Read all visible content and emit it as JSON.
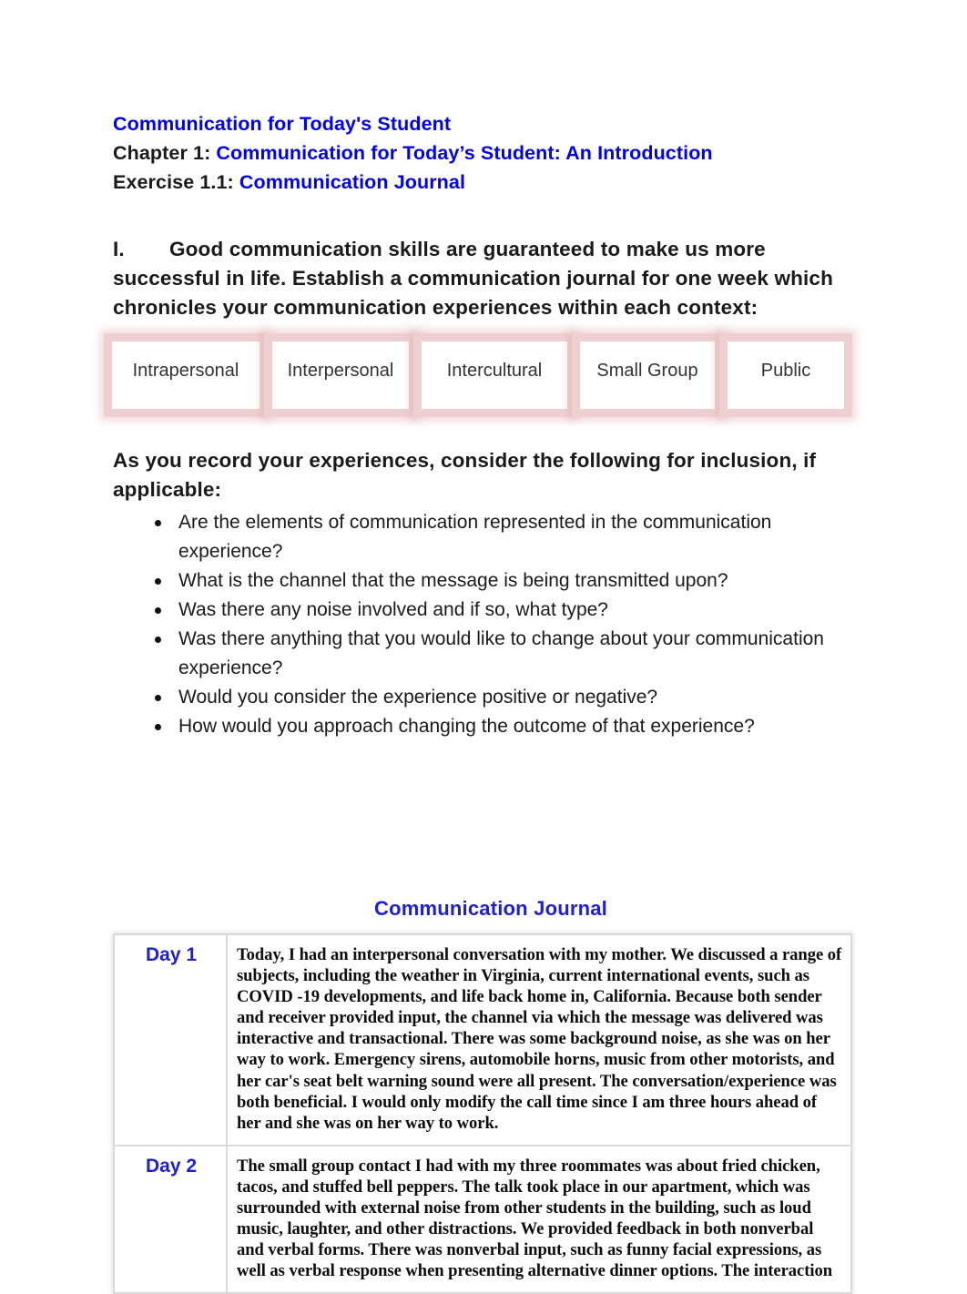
{
  "document": {
    "header": {
      "line1_title": "Communication for Today's Student",
      "line2_prefix": "Chapter 1: ",
      "line2_title": "Communication for Today’s Student: An Introduction",
      "line3_prefix": "Exercise 1.1: ",
      "line3_title": "Communication Journal"
    },
    "prompt": {
      "numeral": "I.",
      "text": "Good communication skills are guaranteed to make us more successful in life. Establish a communication journal for one week which chronicles your communication experiences within each context:"
    },
    "context_boxes": [
      {
        "label": "Intrapersonal"
      },
      {
        "label": "Interpersonal"
      },
      {
        "label": "Intercultural"
      },
      {
        "label": "Small Group"
      },
      {
        "label": "Public"
      }
    ],
    "consider_intro": "As you record your experiences, consider the following for inclusion, if applicable:",
    "bullets": [
      "Are the elements of communication represented in the communication experience?",
      "What is the channel that the message is being transmitted upon?",
      "Was there any noise involved and if so, what type?",
      "Was there anything that you would like to change about your communication experience?",
      "Would you consider the experience positive or negative?",
      "How would you approach changing the outcome of that experience?"
    ],
    "journal": {
      "title": "Communication Journal",
      "rows": [
        {
          "day": "Day 1",
          "entry": "Today, I had an interpersonal conversation with my mother. We discussed a range of subjects, including the weather in Virginia, current international events, such as COVID -19 developments, and life back home in, California. Because both sender and receiver provided input, the channel via which the message was delivered was interactive and transactional. There was some background noise, as she was on her way to work. Emergency sirens, automobile horns, music from other motorists, and her car's seat belt warning sound were all present. The conversation/experience was both beneficial. I would only modify the call time since I am three hours ahead of her and she was on her way to work."
        },
        {
          "day": "Day 2",
          "entry": "The small group contact I had with my three roommates was about fried chicken, tacos, and stuffed bell peppers. The talk took place in our apartment, which was surrounded with external noise from other students in the building, such as loud music, laughter, and other distractions. We provided feedback in both nonverbal and verbal forms. There was nonverbal input, such as funny facial expressions, as well as verbal response when presenting alternative dinner options. The interaction"
        }
      ]
    },
    "colors": {
      "heading_blue": "#0000ee",
      "journal_title_blue": "#1f1fd0",
      "day_label_blue": "#1f1fd0",
      "context_box_border": "#e0a8a8",
      "body_text": "#1a1a1a"
    }
  }
}
